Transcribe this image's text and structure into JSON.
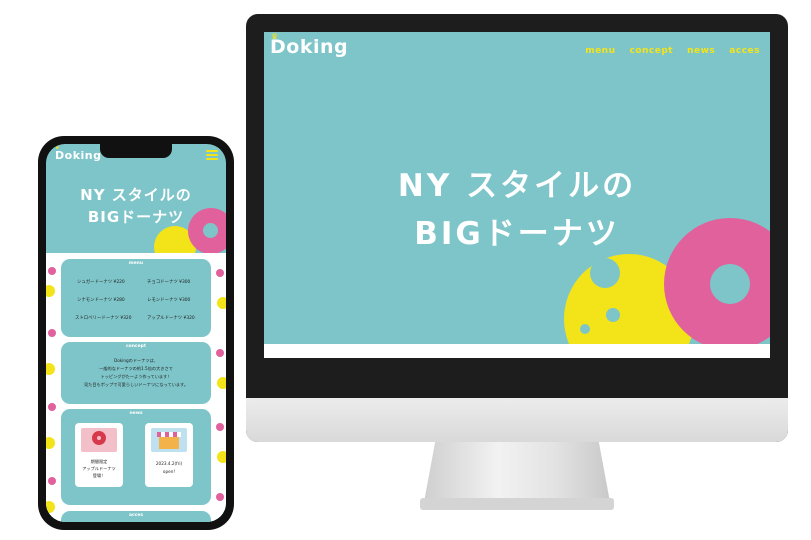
{
  "desktop": {
    "logo": "Doking",
    "nav": [
      "menu",
      "concept",
      "news",
      "acces"
    ],
    "hero_line1": "NY スタイルの",
    "hero_line2": "BIGドーナツ"
  },
  "mobile": {
    "logo": "Doking",
    "hero_line1": "NY スタイルの",
    "hero_line2": "BIGドーナツ",
    "menu": {
      "title": "menu",
      "items": [
        {
          "name": "シュガードーナツ",
          "price": "¥220"
        },
        {
          "name": "チョコドーナツ",
          "price": "¥300"
        },
        {
          "name": "シナモンドーナツ",
          "price": "¥280"
        },
        {
          "name": "レモンドーナツ",
          "price": "¥300"
        },
        {
          "name": "ストロベリードーナツ",
          "price": "¥320"
        },
        {
          "name": "アップルドーナツ",
          "price": "¥320"
        }
      ]
    },
    "concept": {
      "title": "concept",
      "lines": [
        "Dokingのドーナツは、",
        "一般的なドーナツの約1.5倍の大きさで",
        "トッピングがたーよう作っています！",
        "見た目もポップで可愛らしいドーナツになっています。"
      ]
    },
    "news": {
      "title": "news",
      "items": [
        {
          "lines": [
            "期間限定",
            "アップルドーナツ",
            "登場！"
          ]
        },
        {
          "lines": [
            "2023.4.2(fri)",
            "open!"
          ]
        }
      ]
    },
    "access": {
      "title": "acces"
    }
  },
  "colors": {
    "teal": "#7ec5c9",
    "yellow": "#f3e419",
    "pink": "#e0619b",
    "white": "#ffffff"
  }
}
